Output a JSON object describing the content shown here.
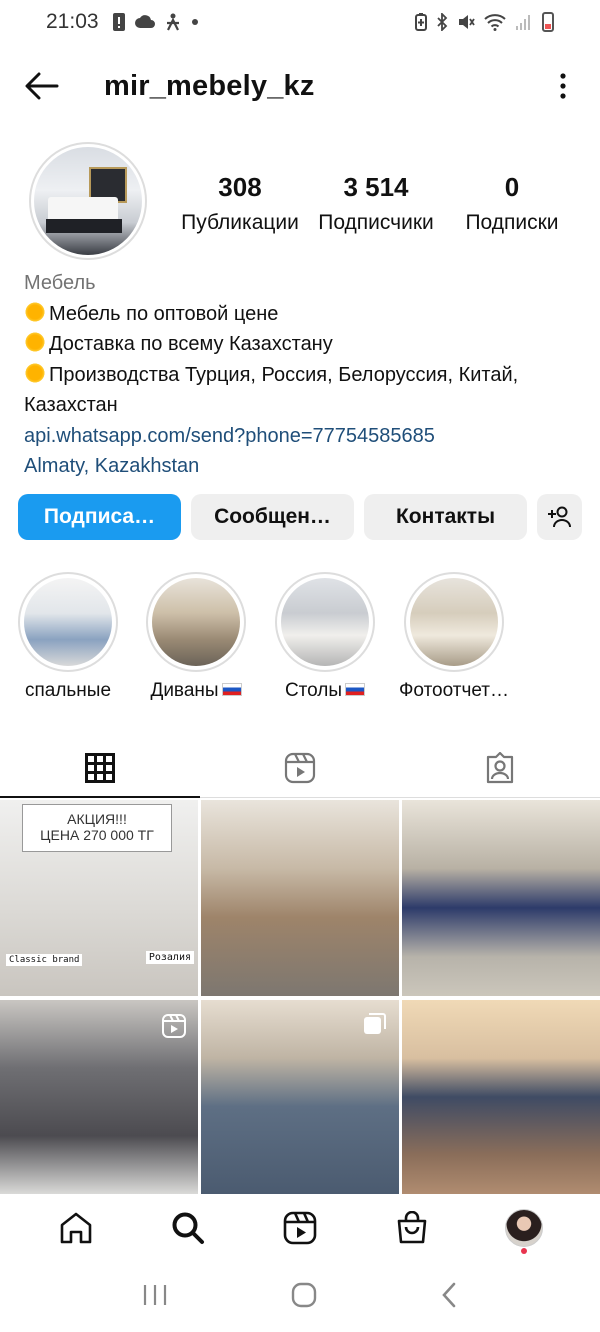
{
  "status_bar": {
    "time": "21:03",
    "icons_left": [
      "alert-icon",
      "cloud-icon",
      "accessibility-icon",
      "dot-icon"
    ],
    "icons_right": [
      "battery-saver-icon",
      "bluetooth-icon",
      "mute-icon",
      "wifi-icon",
      "signal-icon",
      "battery-icon"
    ]
  },
  "header": {
    "username": "mir_mebely_kz"
  },
  "profile": {
    "stats": [
      {
        "value": "308",
        "label": "Публикации"
      },
      {
        "value": "3 514",
        "label": "Подписчики"
      },
      {
        "value": "0",
        "label": "Подписки"
      }
    ],
    "category": "Мебель",
    "bio_lines": [
      "Мебель по оптовой цене",
      "Доставка по всему Казахстану",
      "Производства Турция, Россия, Белоруссия, Китай,",
      "Казахстан"
    ],
    "link": "api.whatsapp.com/send?phone=77754585685",
    "location": "Almaty, Kazakhstan"
  },
  "actions": {
    "follow": "Подписа…",
    "message": "Сообщен…",
    "contacts": "Контакты"
  },
  "highlights": [
    {
      "label": "спальные"
    },
    {
      "label": "Диваны"
    },
    {
      "label": "Столы"
    },
    {
      "label": "Фотоотчет…"
    }
  ],
  "posts": {
    "promo_title": "АКЦИЯ!!!",
    "promo_price": "ЦЕНА 270 000 ТГ",
    "promo_brand": "Classic brand",
    "promo_model": "Розалия"
  },
  "colors": {
    "accent": "#1a9bf0",
    "link": "#1f4e79",
    "notif": "#e8344e"
  }
}
